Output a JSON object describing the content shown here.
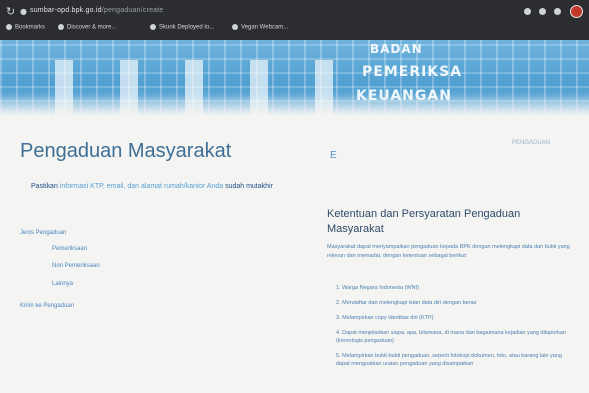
{
  "browser": {
    "url_host": "sumbar-opd.bpk.go.id",
    "url_path": "/pengaduan/create",
    "bookmarks": [
      {
        "label": "Bookmarks"
      },
      {
        "label": "Discover & more..."
      },
      {
        "label": "Skunk Deployed to..."
      },
      {
        "label": "Vegan Webcam..."
      }
    ]
  },
  "banner": {
    "line1": "BADAN",
    "line2": "PEMERIKSA",
    "line3": "KEUANGAN"
  },
  "left": {
    "title": "Pengaduan Masyarakat",
    "notice_prefix": "Pastikan",
    "notice_highlight": "informasi KTP, email, dan alamat rumah/kantor Anda",
    "notice_suffix": "sudah mutakhir",
    "links": [
      {
        "label": "Jenis Pengaduan"
      },
      {
        "label": "Pemeriksaan"
      },
      {
        "label": "Non Pemeriksaan"
      },
      {
        "label": "Lainnya"
      },
      {
        "label": "Kirim ke Pengaduan"
      }
    ]
  },
  "right": {
    "top_label": "PENGADUAN",
    "marker": "E",
    "rules_title": "Ketentuan dan Persyaratan Pengaduan Masyarakat",
    "rules_intro": "Masyarakat dapat menyampaikan pengaduan kepada BPK dengan melengkapi data dan bukti yang relevan dan memadai, dengan ketentuan sebagai berikut:",
    "rules": [
      "1. Warga Negara Indonesia (WNI)",
      "2. Mendaftar dan melengkapi isian data diri dengan benar",
      "3. Melampirkan copy identitas diri (KTP)",
      "4. Dapat menjelaskan siapa, apa, bilamana, di mana dan bagaimana kejadian yang dilaporkan (kronologis pengaduan)",
      "5. Melampirkan bukti-bukti pengaduan, seperti fotokopi dokumen, foto, atau barang lain yang dapat menguatkan uraian pengaduan yang disampaikan"
    ]
  }
}
